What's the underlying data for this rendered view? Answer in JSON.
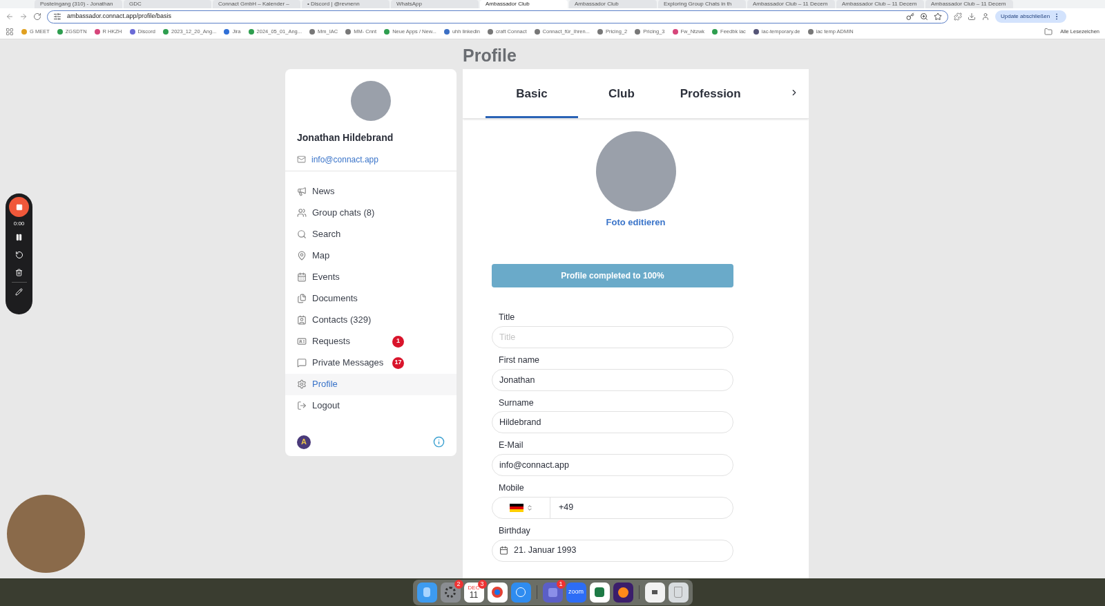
{
  "browser": {
    "tabs": [
      {
        "title": "Posteingang (310) - Jonathan",
        "selected": false
      },
      {
        "title": "GDC",
        "selected": false
      },
      {
        "title": "Connact GmbH – Kalender –",
        "selected": false
      },
      {
        "title": "• Discord | @revnenn",
        "selected": false
      },
      {
        "title": "WhatsApp",
        "selected": false
      },
      {
        "title": "Ambassador Club",
        "selected": true
      },
      {
        "title": "Ambassador Club",
        "selected": false
      },
      {
        "title": "Exploring Group Chats in th",
        "selected": false
      },
      {
        "title": "Ambassador Club – 11 Decem",
        "selected": false
      },
      {
        "title": "Ambassador Club – 11 Decem",
        "selected": false
      },
      {
        "title": "Ambassador Club – 11 Decem",
        "selected": false
      }
    ],
    "url": "ambassador.connact.app/profile/basis",
    "update_button": "Update abschließen",
    "bookmarks": [
      {
        "label": "G MEET",
        "color": "#e0a020"
      },
      {
        "label": "ZGSDTN",
        "color": "#2e9e4f"
      },
      {
        "label": "R HKZH",
        "color": "#d6457a"
      },
      {
        "label": "Discord",
        "color": "#6b6bd6"
      },
      {
        "label": "2023_12_20_Ang...",
        "color": "#2e9e4f"
      },
      {
        "label": "Jira",
        "color": "#2f6fd6"
      },
      {
        "label": "2024_05_01_Ang...",
        "color": "#2e9e4f"
      },
      {
        "label": "Mm_IAC",
        "color": "#777777"
      },
      {
        "label": "MM- Cnnt",
        "color": "#777777"
      },
      {
        "label": "Neue Apps / New...",
        "color": "#2e9e4f"
      },
      {
        "label": "uhh linkedin",
        "color": "#3b6fc4"
      },
      {
        "label": "craft Connact",
        "color": "#777777"
      },
      {
        "label": "Connact_für_Ihren...",
        "color": "#777777"
      },
      {
        "label": "Pricing_2",
        "color": "#777777"
      },
      {
        "label": "Pricing_3",
        "color": "#777777"
      },
      {
        "label": "Fw_Ntzwk",
        "color": "#d6457a"
      },
      {
        "label": "Feedbk iac",
        "color": "#2e9e4f"
      },
      {
        "label": "iac-temporary.de",
        "color": "#555577"
      },
      {
        "label": "iac temp ADMIN",
        "color": "#777777"
      }
    ],
    "all_bookmarks": "Alle Lesezeichen"
  },
  "recorder": {
    "time": "0:00"
  },
  "page": {
    "heading": "Profile",
    "sidebar": {
      "name": "Jonathan Hildebrand",
      "email": "info@connact.app",
      "nav": [
        {
          "label": "News",
          "selected": false
        },
        {
          "label": "Group chats (8)",
          "selected": false
        },
        {
          "label": "Search",
          "selected": false
        },
        {
          "label": "Map",
          "selected": false
        },
        {
          "label": "Events",
          "selected": false
        },
        {
          "label": "Documents",
          "selected": false
        },
        {
          "label": "Contacts (329)",
          "selected": false
        },
        {
          "label": "Requests",
          "badge": "1",
          "selected": false
        },
        {
          "label": "Private Messages",
          "badge": "17",
          "selected": false
        },
        {
          "label": "Profile",
          "selected": true
        },
        {
          "label": "Logout",
          "selected": false
        }
      ],
      "footer_avatar": "A"
    },
    "tabs": [
      {
        "label": "Basic",
        "selected": true
      },
      {
        "label": "Club",
        "selected": false
      },
      {
        "label": "Profession",
        "selected": false
      }
    ],
    "photo_action": "Foto editieren",
    "progress": {
      "label": "Profile completed to 100%",
      "level": 1
    },
    "fields": [
      {
        "kind": "text",
        "label": "Title",
        "placeholder": "Title"
      },
      {
        "kind": "text",
        "label": "First name",
        "value": "Jonathan"
      },
      {
        "kind": "text",
        "label": "Surname",
        "value": "Hildebrand"
      },
      {
        "kind": "text",
        "label": "E-Mail",
        "value": "info@connact.app"
      },
      {
        "kind": "phone",
        "label": "Mobile",
        "value": "+49"
      },
      {
        "kind": "date",
        "label": "Birthday",
        "value": "21. Januar 1993"
      }
    ]
  },
  "dock": [
    [
      {
        "kind": "finder"
      },
      {
        "kind": "settings",
        "badge": "2"
      },
      {
        "kind": "calendar",
        "month": "DEC",
        "day": "11",
        "badge": "3"
      },
      {
        "kind": "chrome"
      },
      {
        "kind": "safari"
      }
    ],
    [
      {
        "kind": "teams",
        "badge": "1"
      },
      {
        "kind": "zoom",
        "label": "zoom"
      },
      {
        "kind": "excel"
      },
      {
        "kind": "firefox"
      }
    ],
    [
      {
        "kind": "file"
      },
      {
        "kind": "trash"
      }
    ]
  ]
}
